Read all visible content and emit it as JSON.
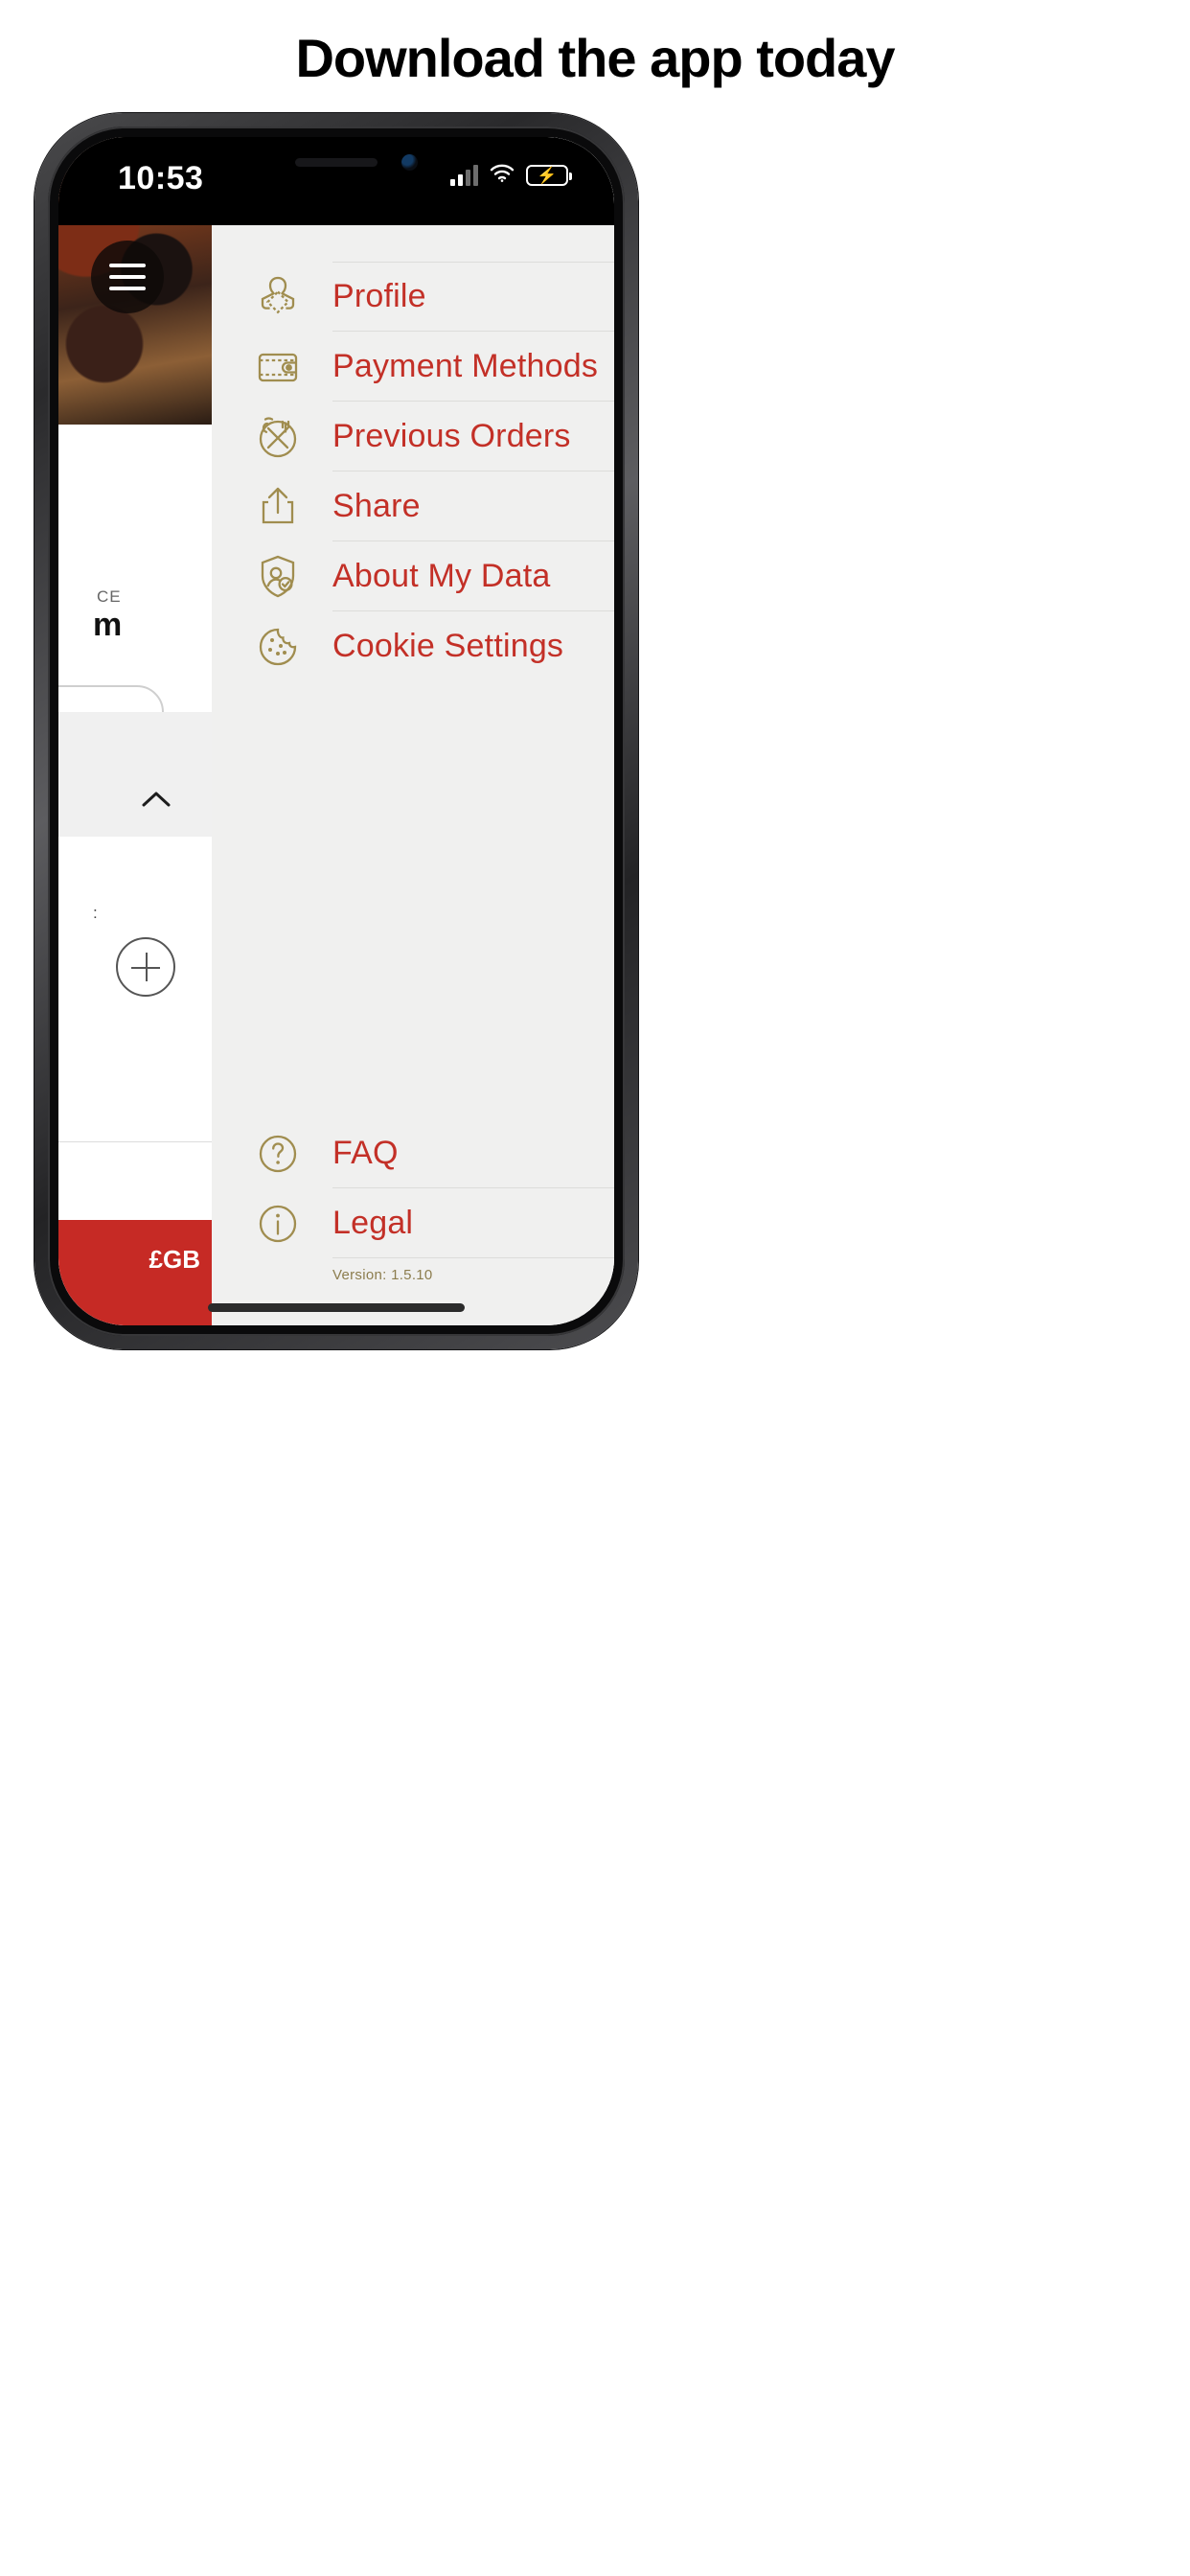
{
  "page": {
    "heading": "Download the app today"
  },
  "status_bar": {
    "time": "10:53",
    "signal_icon": "cellular-signal-icon",
    "wifi_icon": "wifi-icon",
    "battery_icon": "battery-charging-icon",
    "battery_charging_glyph": "⚡"
  },
  "drawer": {
    "menu_button": "menu-hamburger-button",
    "primary_items": [
      {
        "label": "Profile",
        "icon": "profile-icon"
      },
      {
        "label": "Payment Methods",
        "icon": "wallet-icon"
      },
      {
        "label": "Previous Orders",
        "icon": "cutlery-history-icon"
      },
      {
        "label": "Share",
        "icon": "share-icon"
      },
      {
        "label": "About My Data",
        "icon": "data-privacy-icon"
      },
      {
        "label": "Cookie Settings",
        "icon": "cookie-icon"
      }
    ],
    "secondary_items": [
      {
        "label": "FAQ",
        "icon": "question-circle-icon"
      },
      {
        "label": "Legal",
        "icon": "info-circle-icon"
      }
    ],
    "version": "Version: 1.5.10"
  },
  "background_app": {
    "section_label": "CE",
    "price": "m",
    "currency_badge": "£GB",
    "add_icon": "plus-circle-icon",
    "collapse_icon": "chevron-up-icon",
    "dots_label": ":"
  },
  "colors": {
    "accent_red": "#c33027",
    "icon_gold": "#a08d4f",
    "drawer_bg": "#f0f0ef",
    "brand_red_block": "#c62a25",
    "version_text": "#8c7d4e",
    "divider": "#dcdcda"
  }
}
